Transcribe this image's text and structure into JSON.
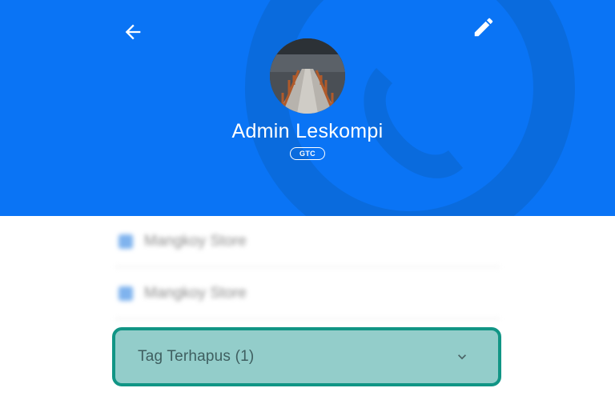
{
  "header": {
    "background_color": "#0a74f5",
    "back_icon": "arrow-left-icon",
    "edit_icon": "pencil-icon"
  },
  "profile": {
    "name": "Admin Leskompi",
    "badge": "GTC",
    "avatar_description": "boardwalk-photo"
  },
  "tags": [
    {
      "label": "Mangkoy Store",
      "checked": true
    },
    {
      "label": "Mangkoy Store",
      "checked": true
    }
  ],
  "deleted_tags": {
    "label": "Tag Terhapus (1)",
    "icon": "chevron-down-icon",
    "highlight_color": "#119585"
  }
}
